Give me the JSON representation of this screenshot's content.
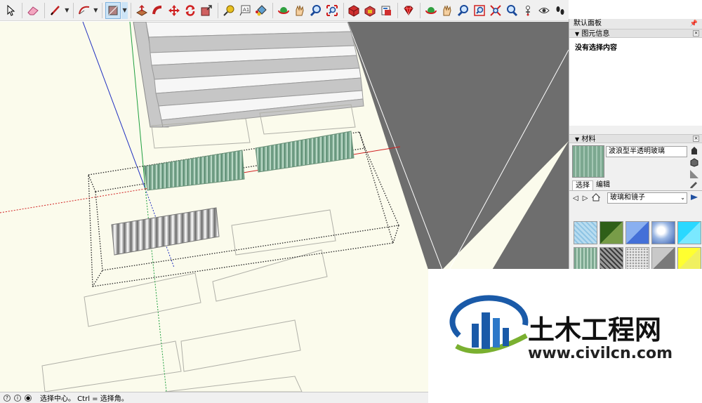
{
  "toolbar": {
    "tools": [
      "select-tool",
      "eraser-tool",
      "line-tool",
      "arc-tool",
      "rectangle-tool",
      "push-pull-tool",
      "follow-me-tool",
      "move-tool",
      "rotate-tool",
      "scale-tool",
      "tape-measure-tool",
      "text-tool",
      "paint-bucket-tool",
      "orbit-tool",
      "pan-tool",
      "zoom-tool",
      "zoom-extents-tool",
      "3d-warehouse-tool",
      "extension-warehouse-tool",
      "layout-tool",
      "ruby-console-tool",
      "position-camera-tool",
      "walk-tool",
      "look-around-tool",
      "section-plane-tool",
      "footprints-tool"
    ]
  },
  "panel": {
    "title": "默认面板",
    "entity_info": {
      "header": "图元信息",
      "content": "没有选择内容"
    },
    "materials": {
      "header": "材料",
      "current_name": "波浪型半透明玻璃",
      "tabs": [
        "选择",
        "编辑"
      ],
      "library": "玻璃和镜子"
    }
  },
  "status": {
    "text": "选择中心。 Ctrl = 选择角。"
  },
  "watermark": {
    "brand": "土木工程网",
    "url": "www.civilcn.com"
  },
  "colors": {
    "viewport_bg": "#fbfbec",
    "sky_gray": "#6e6e6e",
    "axis_red": "#d02020",
    "axis_green": "#20a040",
    "axis_blue": "#2030c0",
    "brand_blue": "#1a5aa8",
    "brand_green": "#7ab030"
  }
}
